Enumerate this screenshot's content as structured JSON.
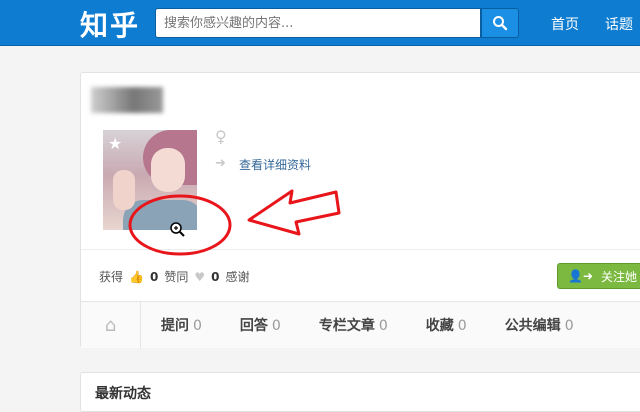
{
  "header": {
    "logo": "知乎",
    "search_placeholder": "搜索你感兴趣的内容...",
    "nav": [
      "首页",
      "话题"
    ]
  },
  "profile": {
    "gender_icon": "female-icon",
    "detail_link": "查看详细资料",
    "stats": {
      "label": "获得",
      "likes": "0",
      "likes_label": "赞同",
      "thanks": "0",
      "thanks_label": "感谢"
    },
    "follow_label": "关注她",
    "tabs": [
      {
        "label": "提问",
        "count": "0"
      },
      {
        "label": "回答",
        "count": "0"
      },
      {
        "label": "专栏文章",
        "count": "0"
      },
      {
        "label": "收藏",
        "count": "0"
      },
      {
        "label": "公共编辑",
        "count": "0"
      }
    ]
  },
  "feed": {
    "title": "最新动态"
  },
  "colors": {
    "topbar": "#0e7cd0",
    "annotation": "#e8151b",
    "follow": "#7cb940"
  }
}
